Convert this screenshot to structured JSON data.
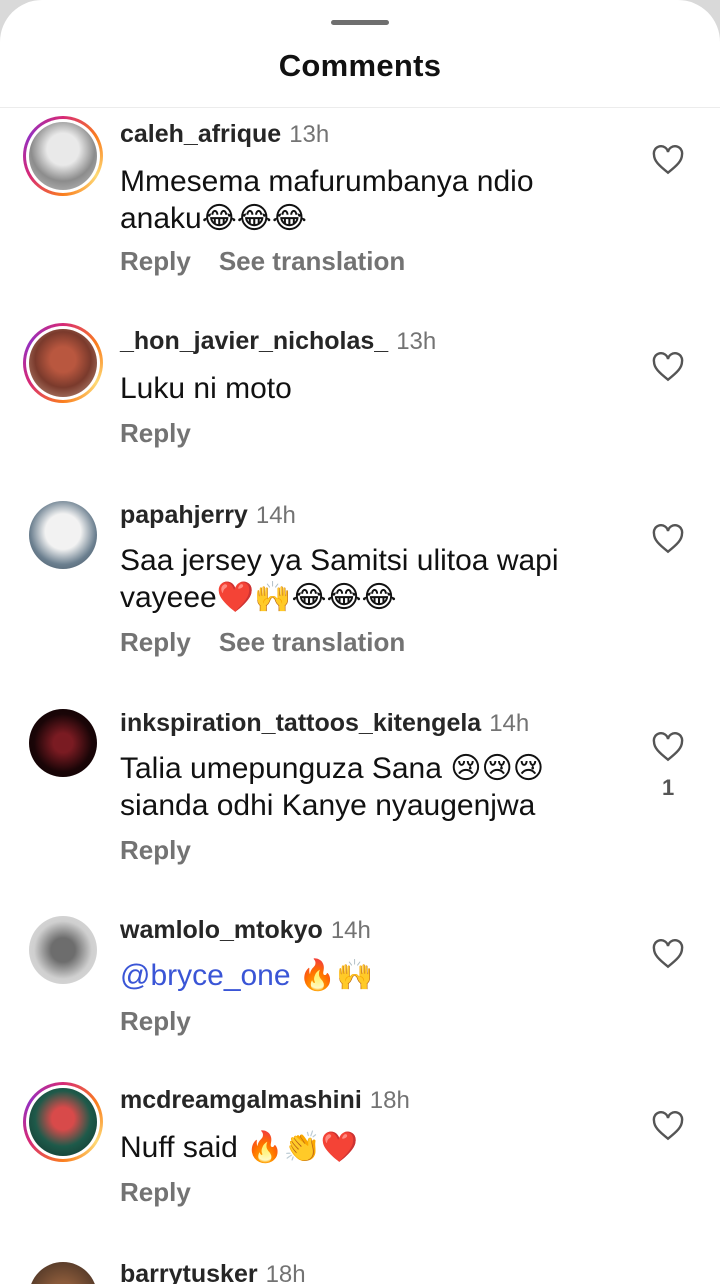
{
  "sheet": {
    "title": "Comments"
  },
  "comments": [
    {
      "username": "caleh_afrique",
      "time": "13h",
      "text": "Mmesema mafurumbanya ndio anaku😂😂😂",
      "reply": "Reply",
      "translate": "See translation",
      "likes": ""
    },
    {
      "username": "_hon_javier_nicholas_",
      "time": "13h",
      "text": "Luku ni moto",
      "reply": "Reply",
      "translate": "",
      "likes": ""
    },
    {
      "username": "papahjerry",
      "time": "14h",
      "text": "Saa jersey ya Samitsi ulitoa wapi vayeee❤️🙌😂😂😂",
      "reply": "Reply",
      "translate": "See translation",
      "likes": ""
    },
    {
      "username": "inkspiration_tattoos_kitengela",
      "time": "14h",
      "text": "Talia umepunguza Sana 😢😢😢 sianda odhi Kanye nyaugenjwa",
      "reply": "Reply",
      "translate": "",
      "likes": "1"
    },
    {
      "username": "wamlolo_mtokyo",
      "time": "14h",
      "mention": "@bryce_one",
      "text": " 🔥🙌",
      "reply": "Reply",
      "translate": "",
      "likes": ""
    },
    {
      "username": "mcdreamgalmashini",
      "time": "18h",
      "text": "Nuff said 🔥👏❤️",
      "reply": "Reply",
      "translate": "",
      "likes": ""
    },
    {
      "username": "barrytusker",
      "time": "18h"
    }
  ],
  "colors": {
    "accent_mention": "#3a55d6",
    "muted": "#737373",
    "story_ring": "#d62976"
  },
  "icons": {
    "like": "heart-outline-icon"
  }
}
